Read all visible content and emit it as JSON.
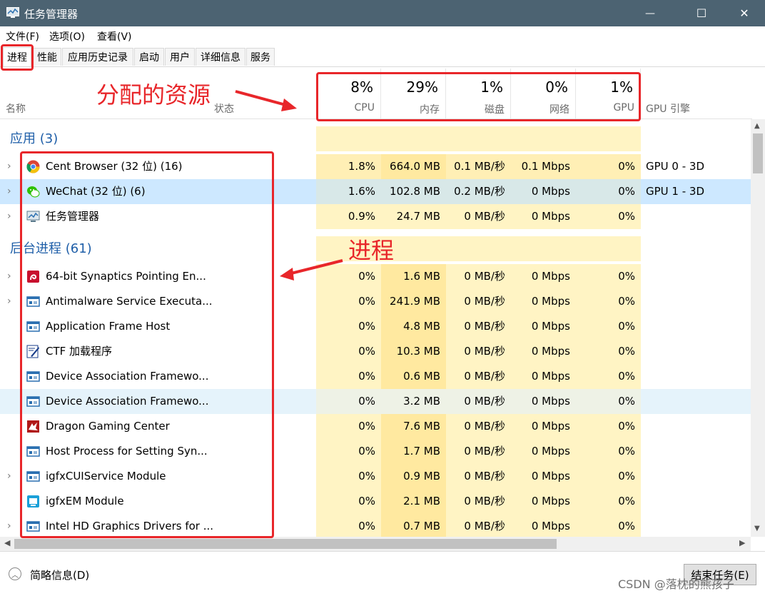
{
  "window": {
    "title": "任务管理器",
    "minimize": "—",
    "maximize": "☐",
    "close": "✕"
  },
  "menu": [
    "文件(F)",
    "选项(O)",
    "查看(V)"
  ],
  "tabs": [
    "进程",
    "性能",
    "应用历史记录",
    "启动",
    "用户",
    "详细信息",
    "服务"
  ],
  "columns": {
    "name": "名称",
    "status": "状态",
    "gpu_engine": "GPU 引擎",
    "cpu": {
      "pct": "8%",
      "label": "CPU"
    },
    "mem": {
      "pct": "29%",
      "label": "内存"
    },
    "disk": {
      "pct": "1%",
      "label": "磁盘"
    },
    "net": {
      "pct": "0%",
      "label": "网络"
    },
    "gpu": {
      "pct": "1%",
      "label": "GPU"
    }
  },
  "groups": {
    "apps": "应用 (3)",
    "background": "后台进程 (61)"
  },
  "apps": [
    {
      "name": "Cent Browser (32 位) (16)",
      "icon": "chrome-icon",
      "cpu": "1.8%",
      "mem": "664.0 MB",
      "disk": "0.1 MB/秒",
      "net": "0.1 Mbps",
      "gpu": "0%",
      "gpu_engine": "GPU 0 - 3D"
    },
    {
      "name": "WeChat (32 位) (6)",
      "icon": "wechat-icon",
      "cpu": "1.6%",
      "mem": "102.8 MB",
      "disk": "0.2 MB/秒",
      "net": "0 Mbps",
      "gpu": "0%",
      "gpu_engine": "GPU 1 - 3D"
    },
    {
      "name": "任务管理器",
      "icon": "task-manager-icon",
      "cpu": "0.9%",
      "mem": "24.7 MB",
      "disk": "0 MB/秒",
      "net": "0 Mbps",
      "gpu": "0%",
      "gpu_engine": ""
    }
  ],
  "background": [
    {
      "name": "64-bit Synaptics Pointing En...",
      "icon": "synaptics-icon",
      "cpu": "0%",
      "mem": "1.6 MB",
      "disk": "0 MB/秒",
      "net": "0 Mbps",
      "gpu": "0%"
    },
    {
      "name": "Antimalware Service Executa...",
      "icon": "service-icon",
      "cpu": "0%",
      "mem": "241.9 MB",
      "disk": "0 MB/秒",
      "net": "0 Mbps",
      "gpu": "0%"
    },
    {
      "name": "Application Frame Host",
      "icon": "service-icon",
      "cpu": "0%",
      "mem": "4.8 MB",
      "disk": "0 MB/秒",
      "net": "0 Mbps",
      "gpu": "0%"
    },
    {
      "name": "CTF 加载程序",
      "icon": "ctf-icon",
      "cpu": "0%",
      "mem": "10.3 MB",
      "disk": "0 MB/秒",
      "net": "0 Mbps",
      "gpu": "0%"
    },
    {
      "name": "Device Association Framewo...",
      "icon": "service-icon",
      "cpu": "0%",
      "mem": "0.6 MB",
      "disk": "0 MB/秒",
      "net": "0 Mbps",
      "gpu": "0%"
    },
    {
      "name": "Device Association Framewo...",
      "icon": "service-icon",
      "cpu": "0%",
      "mem": "3.2 MB",
      "disk": "0 MB/秒",
      "net": "0 Mbps",
      "gpu": "0%"
    },
    {
      "name": "Dragon Gaming Center",
      "icon": "dragon-icon",
      "cpu": "0%",
      "mem": "7.6 MB",
      "disk": "0 MB/秒",
      "net": "0 Mbps",
      "gpu": "0%"
    },
    {
      "name": "Host Process for Setting Syn...",
      "icon": "service-icon",
      "cpu": "0%",
      "mem": "1.7 MB",
      "disk": "0 MB/秒",
      "net": "0 Mbps",
      "gpu": "0%"
    },
    {
      "name": "igfxCUIService Module",
      "icon": "service-icon",
      "cpu": "0%",
      "mem": "0.9 MB",
      "disk": "0 MB/秒",
      "net": "0 Mbps",
      "gpu": "0%"
    },
    {
      "name": "igfxEM Module",
      "icon": "igfx-icon",
      "cpu": "0%",
      "mem": "2.1 MB",
      "disk": "0 MB/秒",
      "net": "0 Mbps",
      "gpu": "0%"
    },
    {
      "name": "Intel HD Graphics Drivers for ...",
      "icon": "service-icon",
      "cpu": "0%",
      "mem": "0.7 MB",
      "disk": "0 MB/秒",
      "net": "0 Mbps",
      "gpu": "0%"
    }
  ],
  "annotations": {
    "resources": "分配的资源",
    "processes": "进程"
  },
  "footer": {
    "fewer_details": "简略信息(D)",
    "end_task": "结束任务(E)",
    "watermark": "CSDN @落枕的熊孩子"
  },
  "colors": {
    "titlebar": "#4c6372",
    "accent_text": "#1e5ea8",
    "heat_light": "#fff4c4",
    "heat_mid": "#ffe9a0",
    "selected_row": "#cde8ff",
    "annotation": "#e8262a"
  }
}
